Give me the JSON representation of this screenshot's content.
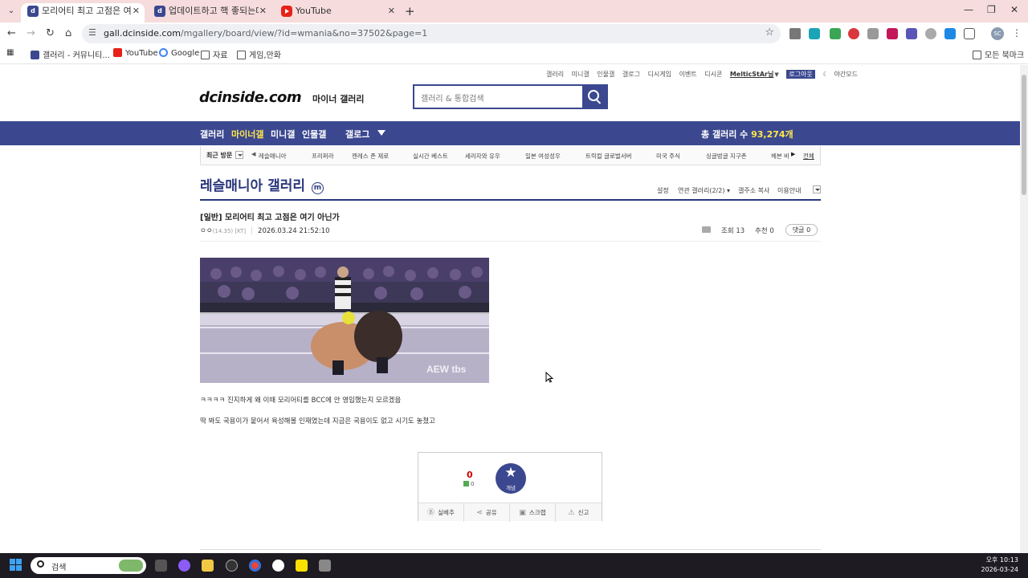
{
  "browser": {
    "tabs": [
      {
        "title": "모리어티 최고 고점은 여기 아닌가",
        "active": true,
        "favicon": "dcinside"
      },
      {
        "title": "업데이트하고 핵 좋되는데 - 컨",
        "active": false,
        "favicon": "dcinside"
      },
      {
        "title": "YouTube",
        "active": false,
        "favicon": "youtube"
      }
    ],
    "url_host": "gall.dcinside.com",
    "url_path": "/mgallery/board/view/?id=wmania&no=37502&page=1",
    "bookmarks": [
      {
        "label": "갤러리 - 커뮤니티...",
        "icon": "dcinside"
      },
      {
        "label": "YouTube",
        "icon": "youtube"
      },
      {
        "label": "Google",
        "icon": "google"
      },
      {
        "label": "자료",
        "icon": "folder"
      },
      {
        "label": "게임,만화",
        "icon": "folder"
      }
    ],
    "all_bookmarks": "모든 북마크"
  },
  "site": {
    "toplinks": [
      "갤러리",
      "미니갤",
      "인물갤",
      "갤로그",
      "디시게임",
      "이벤트",
      "디시콘"
    ],
    "username": "MelticStAr님",
    "logout": "로그아웃",
    "night_mode": "야간모드",
    "logo": "dcinside.com",
    "logo_sub": "마이너 갤러리",
    "search_placeholder": "갤러리 & 통합검색",
    "gnb": [
      "갤러리",
      "마이너갤",
      "미니갤",
      "인물갤",
      "갤로그"
    ],
    "gallery_count_label": "총 갤러리 수",
    "gallery_count": "93,274개",
    "recent_label": "최근 방문",
    "recent": [
      "레슬매니아",
      "프리퍼라",
      "젠레스 존 제로",
      "실시간 베스트",
      "세리자와 유우",
      "일본 여성성우",
      "트릭컬 글로벌서버",
      "미국 주식",
      "싱글벙글 지구촌",
      "헤븐 바"
    ],
    "recent_all": "전체",
    "accent": "#3b4890",
    "highlight": "#ffe74a"
  },
  "gallery": {
    "title": "레슬매니아 갤러리",
    "badge": "m",
    "menu": [
      "설정",
      "연관 갤러리(2/2)",
      "갤주소 복사",
      "이용안내"
    ]
  },
  "post": {
    "title": "[일반] 모리어티 최고 고점은 여기 아닌가",
    "writer": "ㅇㅇ",
    "ip": "(14.35) [KT]",
    "date": "2026.03.24 21:52:10",
    "views": "조회 13",
    "recommend": "추천 0",
    "comments": "댓글 0",
    "body": [
      "ㅋㅋㅋㅋ 진지하게 왜 이때 모리어티를 BCC에 안 영입했는지 모르겠음",
      "딱 봐도 국용이가 붙어서 육성해볼 인재였는데 지금은 국용이도 없고 시기도 놓쳤고"
    ],
    "image_watermark": "AEW tbs"
  },
  "vote": {
    "up_count": "0",
    "fix_count": "0",
    "up_label": "개념",
    "buttons": [
      {
        "label": "실베추",
        "icon": "B"
      },
      {
        "label": "공유",
        "icon": "share"
      },
      {
        "label": "스크랩",
        "icon": "folder"
      },
      {
        "label": "신고",
        "icon": "siren"
      }
    ]
  },
  "taskbar": {
    "search": "검색",
    "time": "오후 10:13",
    "date": "2026-03-24"
  }
}
